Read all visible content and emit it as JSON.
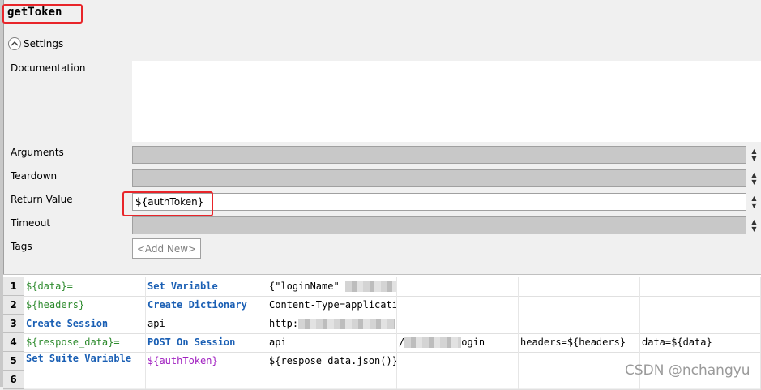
{
  "keyword": {
    "name": "getToken"
  },
  "settings": {
    "label": "Settings",
    "fields": {
      "documentation": {
        "label": "Documentation",
        "value": ""
      },
      "arguments": {
        "label": "Arguments",
        "value": ""
      },
      "teardown": {
        "label": "Teardown",
        "value": ""
      },
      "return_value": {
        "label": "Return Value",
        "value": "${authToken}"
      },
      "timeout": {
        "label": "Timeout",
        "value": ""
      },
      "tags": {
        "label": "Tags",
        "add_label": "<Add New>"
      }
    }
  },
  "grid": {
    "rows": [
      {
        "num": "1",
        "cells": [
          "${data}=",
          "Set Variable",
          "{\"loginName\"",
          "",
          "",
          ""
        ]
      },
      {
        "num": "2",
        "cells": [
          "${headers}",
          "Create Dictionary",
          "Content-Type=applicatio",
          "",
          "",
          ""
        ]
      },
      {
        "num": "3",
        "cells": [
          "Create Session",
          "api",
          "http:",
          "",
          "",
          ""
        ]
      },
      {
        "num": "4",
        "cells": [
          "${respose_data}=",
          "POST On Session",
          "api",
          "/",
          "headers=${headers}",
          "data=${data}"
        ],
        "extra": "ogin"
      },
      {
        "num": "5",
        "cells": [
          "Set Suite Variable",
          "${authToken}",
          "${respose_data.json()}|",
          "",
          "",
          ""
        ]
      },
      {
        "num": "6",
        "cells": [
          "",
          "",
          "",
          "",
          "",
          ""
        ]
      }
    ]
  },
  "watermark": "CSDN @nchangyu",
  "colors": {
    "highlight": "#e8252a",
    "keyword": "#1a5fb4",
    "variable": "#2e8b2e",
    "return_var": "#a020c0"
  }
}
